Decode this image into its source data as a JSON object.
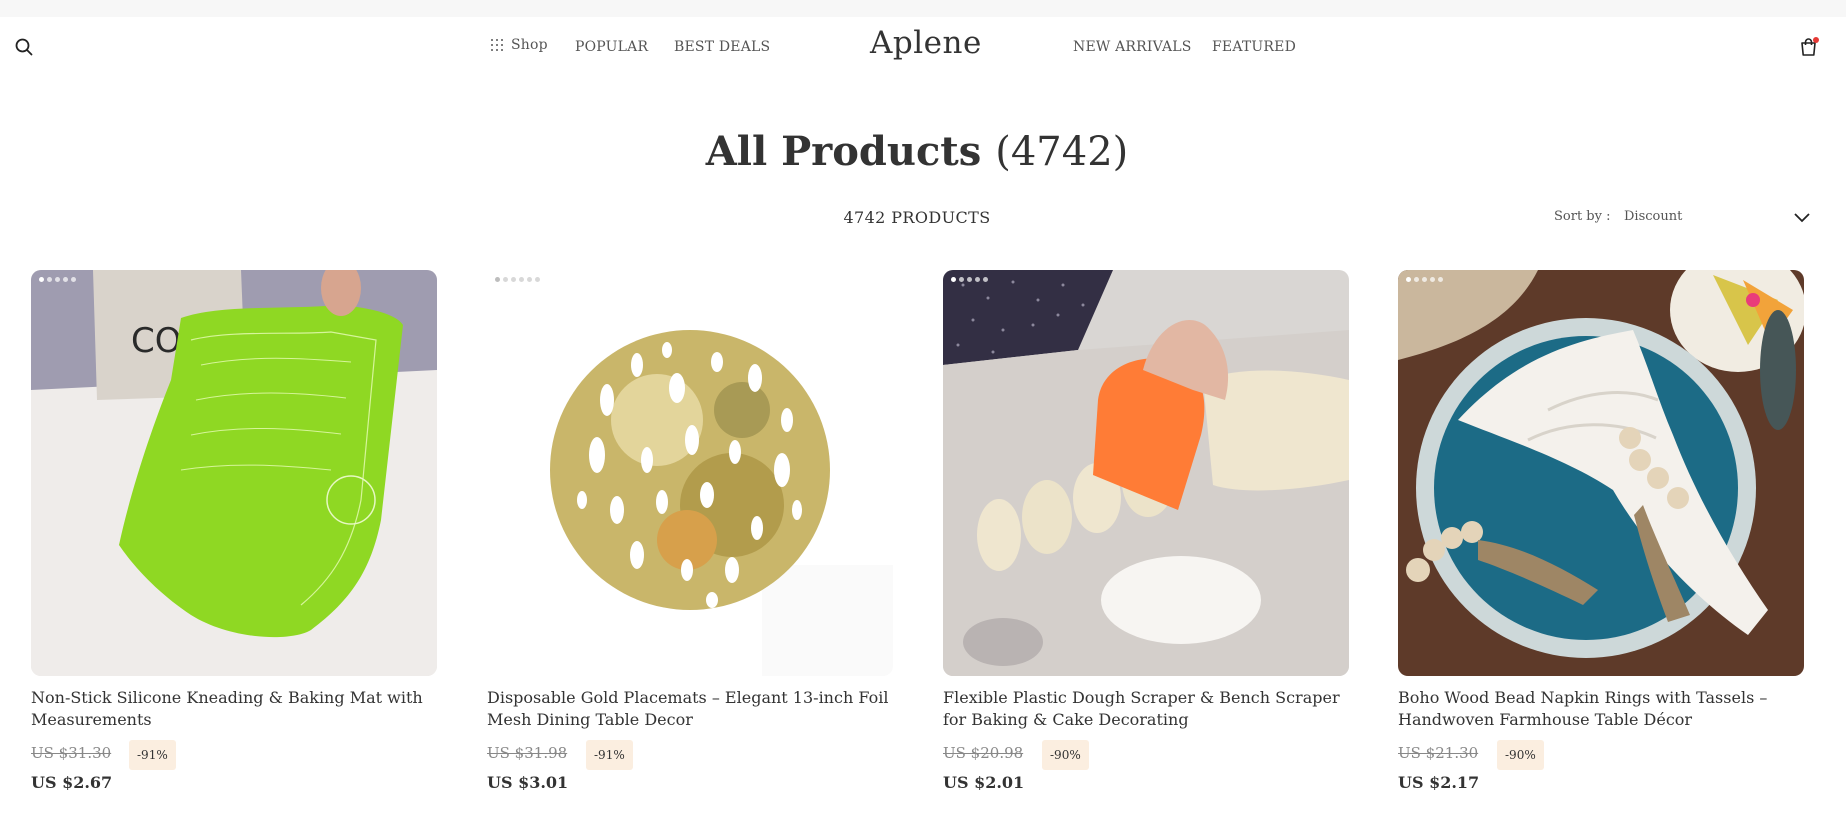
{
  "brand": {
    "logo": "Aplene",
    "accent": "#e53935"
  },
  "header": {
    "search_icon": "search-icon",
    "cart_icon": "shopping-bag-icon",
    "nav_left": [
      {
        "label": "Shop",
        "icon": "grid-icon"
      },
      {
        "label": "POPULAR"
      },
      {
        "label": "BEST DEALS"
      }
    ],
    "nav_right": [
      {
        "label": "NEW ARRIVALS"
      },
      {
        "label": "FEATURED"
      }
    ]
  },
  "page": {
    "title": "All Products",
    "title_count": "(4742)",
    "products_count": "4742 PRODUCTS",
    "sort_label": "Sort by :",
    "sort_value": "Discount"
  },
  "products": [
    {
      "title": "Non-Stick Silicone Kneading & Baking Mat with Measurements",
      "old_price": "US $31.30",
      "discount": "-91%",
      "price": "US $2.67",
      "image_text": "COOKIN"
    },
    {
      "title": "Disposable Gold Placemats – Elegant 13-inch Foil Mesh Dining Table Decor",
      "old_price": "US $31.98",
      "discount": "-91%",
      "price": "US $3.01"
    },
    {
      "title": "Flexible Plastic Dough Scraper & Bench Scraper for Baking & Cake Decorating",
      "old_price": "US $20.98",
      "discount": "-90%",
      "price": "US $2.01"
    },
    {
      "title": "Boho Wood Bead Napkin Rings with Tassels – Handwoven Farmhouse Table Décor",
      "old_price": "US $21.30",
      "discount": "-90%",
      "price": "US $2.17"
    }
  ]
}
